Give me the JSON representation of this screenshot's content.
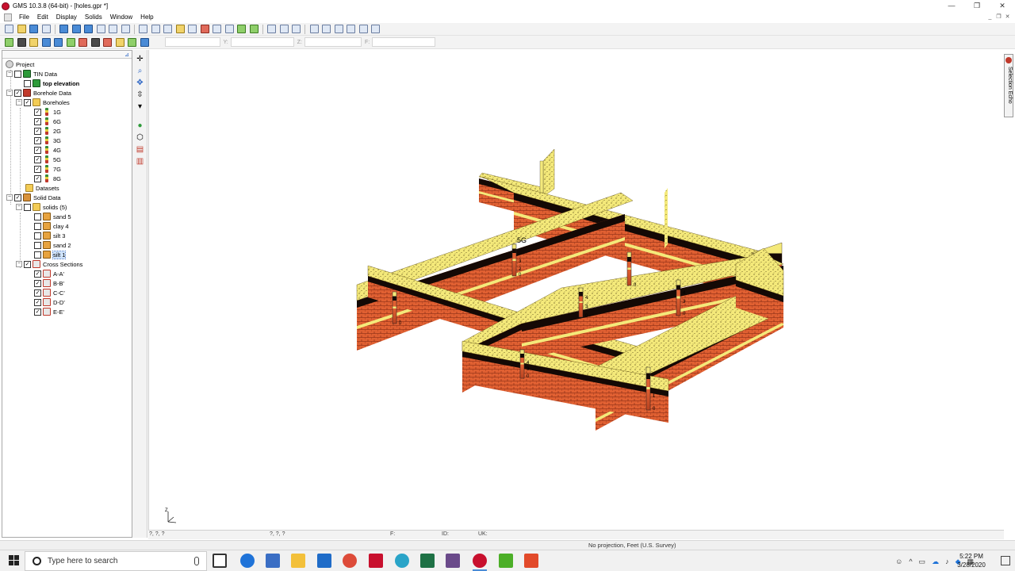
{
  "window": {
    "title": "GMS 10.3.8 (64-bit) - [holes.gpr *]",
    "controls": [
      "—",
      "❐",
      "✕"
    ]
  },
  "menu": [
    "File",
    "Edit",
    "Display",
    "Solids",
    "Window",
    "Help"
  ],
  "mdi_controls": [
    "_",
    "❐",
    "✕"
  ],
  "coord_fields": {
    "y_label": "Y:",
    "z_label": "Z:",
    "f_label": "F:"
  },
  "tree": {
    "project": "Project",
    "tin_data": "TIN Data",
    "tin_item": "top elevation",
    "borehole_data": "Borehole Data",
    "boreholes_folder": "Boreholes",
    "boreholes": [
      "1G",
      "6G",
      "2G",
      "3G",
      "4G",
      "5G",
      "7G",
      "8G"
    ],
    "datasets": "Datasets",
    "solid_data": "Solid Data",
    "solids_folder": "solids (5)",
    "solids": [
      "sand 5",
      "clay 4",
      "silt 3",
      "sand 2",
      "silt 1"
    ],
    "cross_sections": "Cross Sections",
    "sections": [
      "A-A'",
      "B-B'",
      "C-C'",
      "D-D'",
      "E-E'"
    ]
  },
  "viewport": {
    "borehole_label": "5G",
    "depth_labels": [
      "3",
      "2",
      "0",
      "0",
      "4",
      "3",
      "0",
      "0",
      "4",
      "3",
      "0",
      "0",
      "0",
      "3",
      "0",
      "4",
      "3",
      "0",
      "1",
      "0"
    ],
    "axis_label": "Z"
  },
  "selection_echo": "Selection Echo",
  "vp_status": {
    "coords": "?, ?, ?",
    "coords2": "?, ?, ?",
    "f": "F:",
    "id": "ID:",
    "uk": "UK:"
  },
  "status": {
    "projection": "No projection, Feet (U.S. Survey)"
  },
  "taskbar": {
    "search_placeholder": "Type here to search",
    "time": "5:22 PM",
    "date": "3/28/2020"
  },
  "colors": {
    "sand": "#f4e97a",
    "clay": "#1a0c06",
    "silt": "#e2663a",
    "silt_dark": "#7a2410",
    "accent": "#c8102e"
  }
}
